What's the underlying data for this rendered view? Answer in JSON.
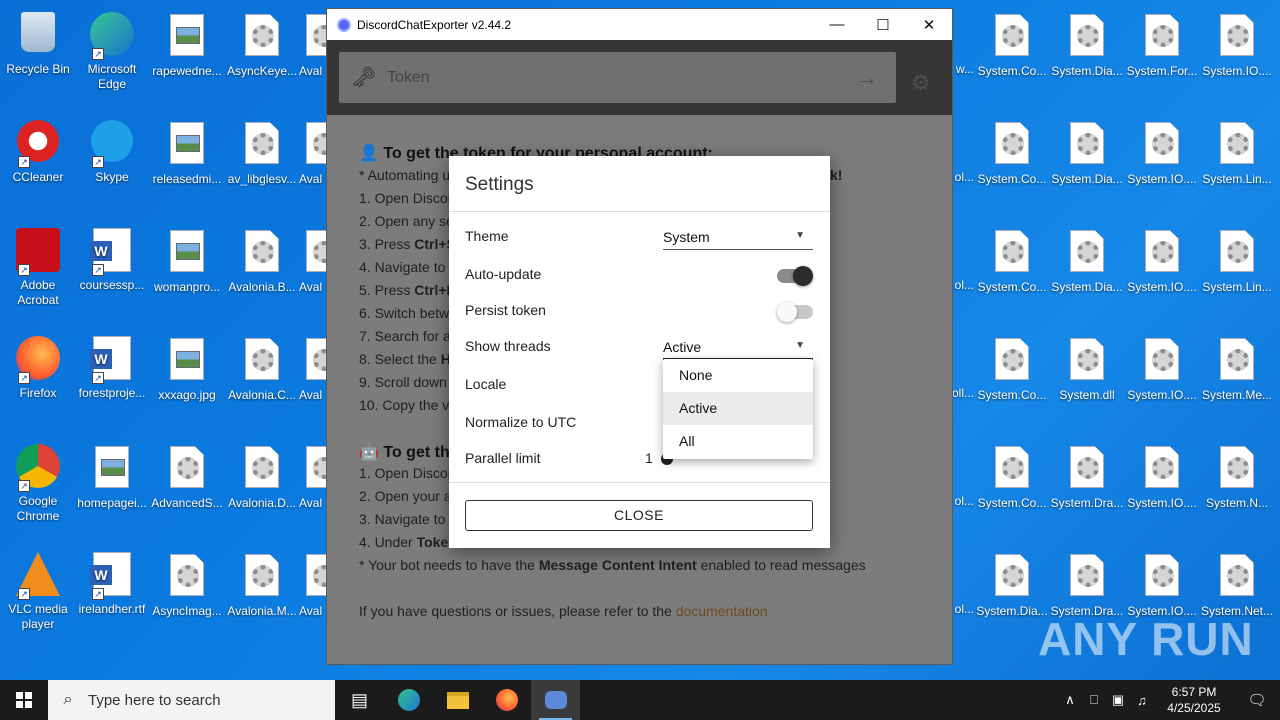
{
  "desktop": {
    "left_icons": [
      {
        "label": "Recycle Bin"
      },
      {
        "label": "Microsoft Edge"
      },
      {
        "label": "rapewedne..."
      },
      {
        "label": "AsyncKeye..."
      },
      {
        "label": "Aval"
      },
      {
        "label": "CCleaner"
      },
      {
        "label": "Skype"
      },
      {
        "label": "releasedmi..."
      },
      {
        "label": "av_libglesv..."
      },
      {
        "label": "Aval"
      },
      {
        "label": "Adobe Acrobat"
      },
      {
        "label": "coursessp..."
      },
      {
        "label": "womanpro..."
      },
      {
        "label": "Avalonia.B..."
      },
      {
        "label": "Aval"
      },
      {
        "label": "Firefox"
      },
      {
        "label": "forestproje..."
      },
      {
        "label": "xxxago.jpg"
      },
      {
        "label": "Avalonia.C..."
      },
      {
        "label": "Aval"
      },
      {
        "label": "Google Chrome"
      },
      {
        "label": "homepagei..."
      },
      {
        "label": "AdvancedS..."
      },
      {
        "label": "Avalonia.D..."
      },
      {
        "label": "Aval"
      },
      {
        "label": "VLC media player"
      },
      {
        "label": "irelandher.rtf"
      },
      {
        "label": "AsyncImag..."
      },
      {
        "label": "Avalonia.M..."
      },
      {
        "label": "Aval"
      }
    ],
    "right_icons": [
      [
        "w...",
        "System.Co...",
        "System.Dia...",
        "System.For...",
        "System.IO...."
      ],
      [
        "ol...",
        "System.Co...",
        "System.Dia...",
        "System.IO....",
        "System.Lin..."
      ],
      [
        "ol...",
        "System.Co...",
        "System.Dia...",
        "System.IO....",
        "System.Lin..."
      ],
      [
        "oll...",
        "System.Co...",
        "System.dll",
        "System.IO....",
        "System.Me..."
      ],
      [
        "ol...",
        "System.Co...",
        "System.Dra...",
        "System.IO....",
        "System.N..."
      ],
      [
        "ol...",
        "System.Dia...",
        "System.Dra...",
        "System.IO....",
        "System.Net..."
      ]
    ],
    "watermark": "ANY RUN"
  },
  "window": {
    "title": "DiscordChatExporter v2.44.2",
    "token_placeholder": "Token"
  },
  "instructions": {
    "personal_heading": "To get the token for your personal account:",
    "personal_lines": [
      "* Automating u",
      "1. Open Discor",
      "2. Open any se",
      "3. Press Ctrl+S",
      "4. Navigate to t",
      "5. Press Ctrl+R",
      "6. Switch betw",
      "7. Search for a",
      "8. Select the H",
      "9. Scroll down t",
      "10. Copy the va"
    ],
    "personal_tail_k": "k!",
    "bot_heading": "To get the",
    "bot_lines": [
      "1. Open Discor",
      "2. Open your ap",
      "3. Navigate to t",
      "4. Under Token"
    ],
    "bot_note_prefix": "* Your bot needs to have the ",
    "bot_note_bold": "Message Content Intent",
    "bot_note_suffix": " enabled to read messages",
    "help_prefix": "If you have questions or issues, please refer to the ",
    "help_link": "documentation"
  },
  "settings": {
    "title": "Settings",
    "theme_label": "Theme",
    "theme_value": "System",
    "autoupdate_label": "Auto-update",
    "autoupdate_on": true,
    "persist_label": "Persist token",
    "persist_on": false,
    "threads_label": "Show threads",
    "threads_value": "Active",
    "locale_label": "Locale",
    "utc_label": "Normalize to UTC",
    "parallel_label": "Parallel limit",
    "parallel_value": "1",
    "close_label": "CLOSE",
    "thread_options": [
      "None",
      "Active",
      "All"
    ],
    "thread_selected": "Active"
  },
  "taskbar": {
    "search_placeholder": "Type here to search",
    "time": "6:57 PM",
    "date": "4/25/2025"
  }
}
